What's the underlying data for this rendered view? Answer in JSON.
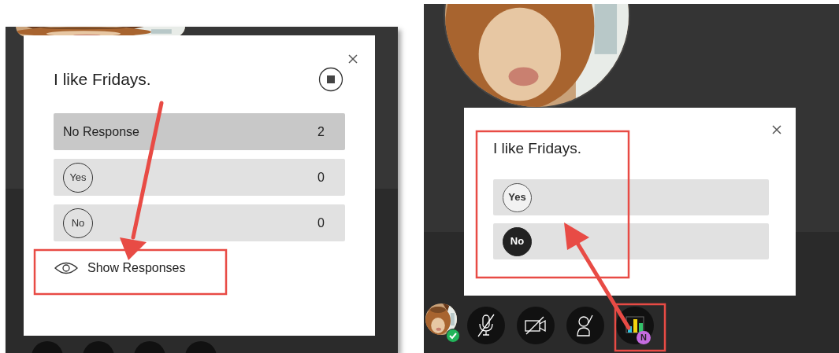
{
  "left_screen": {
    "poll": {
      "question": "I like Fridays.",
      "results": [
        {
          "kind": "summary",
          "label": "No Response",
          "count": "2"
        },
        {
          "kind": "option",
          "label": "Yes",
          "count": "0"
        },
        {
          "kind": "option",
          "label": "No",
          "count": "0"
        }
      ],
      "show_responses": "Show Responses"
    }
  },
  "right_screen": {
    "poll": {
      "question": "I like Fridays.",
      "options": [
        {
          "label": "Yes",
          "selected": false
        },
        {
          "label": "No",
          "selected": true
        }
      ]
    },
    "toolbar": {
      "poll_badge": "N"
    }
  }
}
